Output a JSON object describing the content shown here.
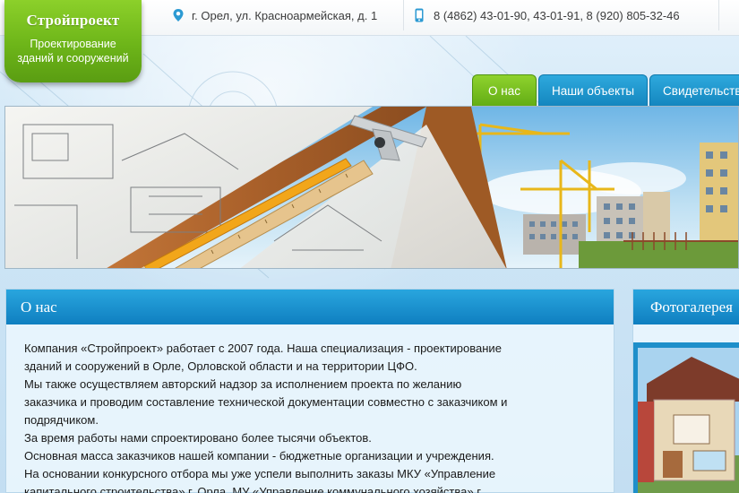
{
  "header": {
    "address": "г. Орел, ул. Красноармейская, д. 1",
    "phones": "8 (4862) 43-01-90, 43-01-91, 8 (920) 805-32-46"
  },
  "logo": {
    "title": "Стройпроект",
    "subtitle_line1": "Проектирование",
    "subtitle_line2": "зданий и сооружений"
  },
  "nav": {
    "tabs": [
      {
        "label": "О нас",
        "active": true
      },
      {
        "label": "Наши объекты",
        "active": false
      },
      {
        "label": "Свидетельств",
        "active": false
      }
    ]
  },
  "about": {
    "title": "О нас",
    "lines": [
      "Компания «Стройпроект»  работает с 2007 года.  Наша специализация - проектирование",
      "зданий и сооружений в Орле, Орловской области и на территории ЦФО.",
      "Мы также осуществляем  авторский надзор за исполнением проекта по желанию",
      "заказчика и проводим составление технической документации совместно с заказчиком и",
      "подрядчиком.",
      "За время работы нами спроектировано более тысячи объектов.",
      "Основная масса заказчиков  нашей компании  - бюджетные организации и учреждения.",
      "На основании конкурсного отбора мы уже успели выполнить заказы МКУ  «Управление",
      "капитального строительства»  г. Орла, МУ «Управление коммунального хозяйства»  г."
    ]
  },
  "gallery": {
    "title": "Фотогалерея"
  },
  "icons": {
    "address": "map-pin-icon",
    "phone": "phone-icon"
  },
  "colors": {
    "brand_green": "#6db519",
    "accent_blue": "#1486bf",
    "text": "#1a1a1a"
  }
}
